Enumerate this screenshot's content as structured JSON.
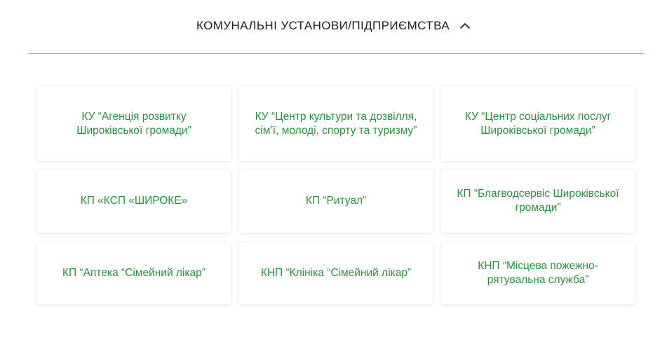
{
  "header": {
    "title": "КОМУНАЛЬНІ УСТАНОВИ/ПІДПРИЄМСТВА",
    "toggle_icon": "chevron-up-icon"
  },
  "colors": {
    "accent_green": "#2f8f3e",
    "divider_green": "#7fc08e",
    "title_text": "#1f1f1f"
  },
  "institutions": [
    {
      "label": "КУ “Агенція розвитку Широківської громади”"
    },
    {
      "label": "КУ “Центр культури та дозвілля, сім’ї, молоді, спорту та туризму”"
    },
    {
      "label": "КУ “Центр соціальних послуг Широківської громади”"
    },
    {
      "label": "КП «КСП «ШИРОКЕ»"
    },
    {
      "label": "КП “Ритуал”"
    },
    {
      "label": "КП “Благводсервіс Широківської громади”"
    },
    {
      "label": "КП “Аптека “Сімейний лікар”"
    },
    {
      "label": "КНП “Клініка “Сімейний лікар”"
    },
    {
      "label": "КНП “Місцева пожежно-рятувальна служба”"
    }
  ]
}
